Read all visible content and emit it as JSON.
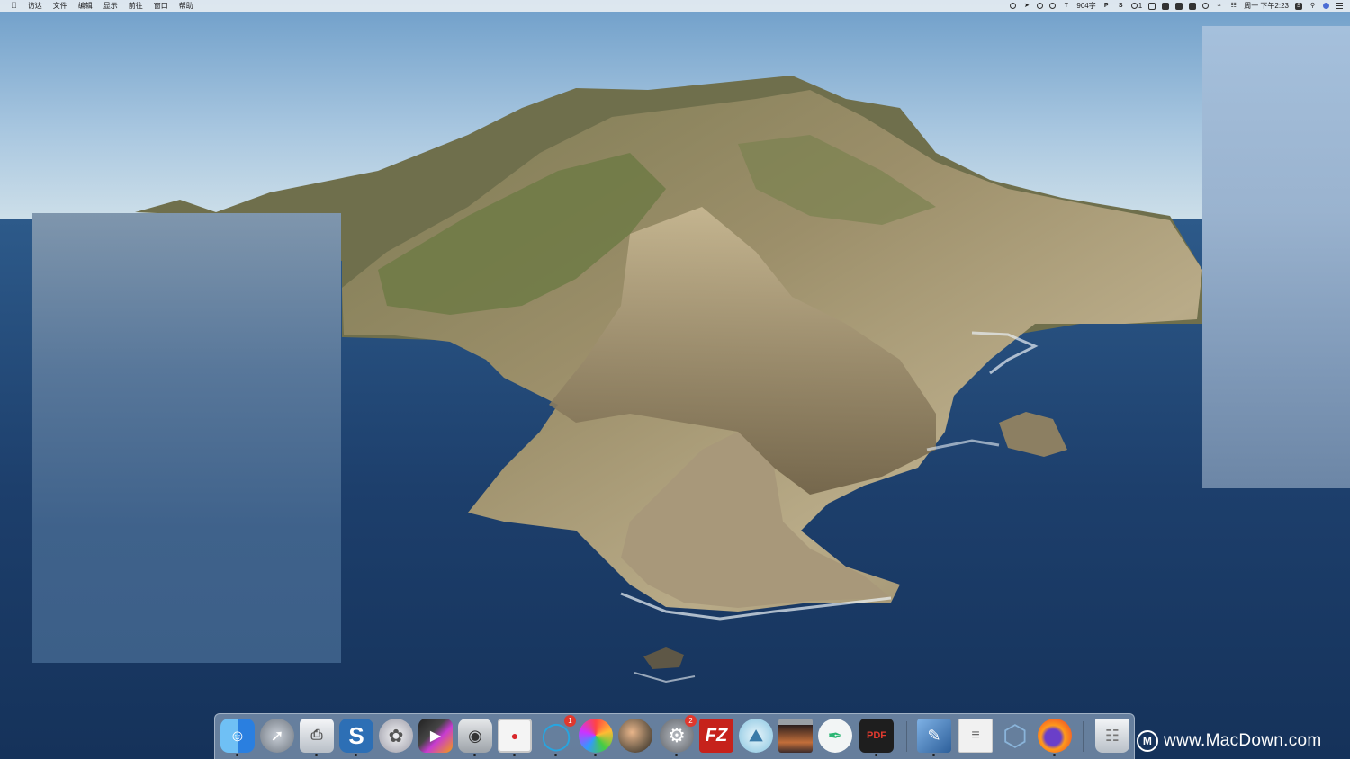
{
  "menubar": {
    "apple_icon": "apple-icon",
    "items": [
      "访达",
      "文件",
      "编辑",
      "显示",
      "前往",
      "窗口",
      "帮助"
    ],
    "status": {
      "word_count": "904字",
      "notification_count": "1",
      "clock": "周一 下午2:23"
    }
  },
  "dock": {
    "apps": [
      {
        "name": "finder",
        "icon": "finder-icon",
        "color": "#3a8ee8"
      },
      {
        "name": "launchpad",
        "icon": "rocket-icon",
        "color": "#9aa3ad"
      },
      {
        "name": "printer",
        "icon": "printer-icon",
        "color": "#d8dde3"
      },
      {
        "name": "scrivener",
        "icon": "s-icon",
        "color": "#2d6fb5",
        "glyph": "S"
      },
      {
        "name": "motion",
        "icon": "film-reel-icon",
        "color": "#c9c9d1"
      },
      {
        "name": "final-cut-pro",
        "icon": "clapper-icon",
        "color": "#3a3a3a"
      },
      {
        "name": "robot-app",
        "icon": "robot-icon",
        "color": "#d0d3d6"
      },
      {
        "name": "screen-recorder",
        "icon": "record-icon",
        "color": "#f2f2f2"
      },
      {
        "name": "mindnode",
        "icon": "nodes-icon",
        "color": "#27a5e0",
        "badge": "1"
      },
      {
        "name": "color-wheel",
        "icon": "colorwheel-icon",
        "color": "#e85d75"
      },
      {
        "name": "app-planet",
        "icon": "planet-icon",
        "color": "#7a6650"
      },
      {
        "name": "system-preferences",
        "icon": "gear-icon",
        "color": "#8e9297",
        "badge": "2"
      },
      {
        "name": "filezilla",
        "icon": "filezilla-icon",
        "color": "#c6221b",
        "glyph": "FZ"
      },
      {
        "name": "image-viewer",
        "icon": "photo-icon",
        "color": "#bfe0ef"
      },
      {
        "name": "photo-slideshow",
        "icon": "photo-frame-icon",
        "color": "#3b2b2b"
      },
      {
        "name": "pen-app",
        "icon": "pen-icon",
        "color": "#eef2f2"
      },
      {
        "name": "pdf-to-image",
        "icon": "pdf-icon",
        "color": "#1e1e1e",
        "glyph": "PDF"
      },
      {
        "name": "xcode-instruments",
        "icon": "blueprint-icon",
        "color": "#4a86c8"
      },
      {
        "name": "textedit",
        "icon": "document-icon",
        "color": "#efefef"
      },
      {
        "name": "hexagon-app",
        "icon": "hexagon-icon",
        "color": "#6a9ac7"
      },
      {
        "name": "firefox",
        "icon": "firefox-icon",
        "color": "#ff6a1a"
      },
      {
        "name": "trash",
        "icon": "trash-icon",
        "color": "#d9dde2"
      }
    ]
  },
  "watermark": {
    "logo": "M",
    "text": "www.MacDown.com"
  }
}
